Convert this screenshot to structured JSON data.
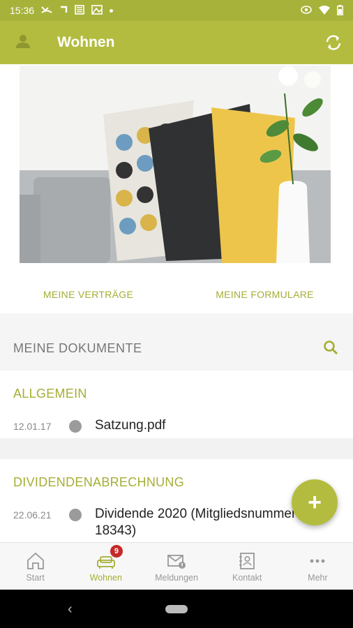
{
  "statusbar": {
    "time": "15:36"
  },
  "appbar": {
    "title": "Wohnen"
  },
  "links": {
    "contracts": "MEINE VERTRÄGE",
    "forms": "MEINE FORMULARE"
  },
  "documents": {
    "header": "MEINE DOKUMENTE",
    "sections": [
      {
        "title": "ALLGEMEIN",
        "items": [
          {
            "date": "12.01.17",
            "name": "Satzung.pdf"
          }
        ]
      },
      {
        "title": "DIVIDENDENABRECHNUNG",
        "items": [
          {
            "date": "22.06.21",
            "name": "Dividende 2020 (Mitgliedsnummer 18343)"
          }
        ]
      }
    ]
  },
  "fab": {
    "label": "+"
  },
  "bottom_nav": {
    "items": [
      {
        "label": "Start",
        "icon": "home-icon"
      },
      {
        "label": "Wohnen",
        "icon": "sofa-icon",
        "badge": "9",
        "active": true
      },
      {
        "label": "Meldungen",
        "icon": "mail-alert-icon"
      },
      {
        "label": "Kontakt",
        "icon": "contact-book-icon"
      },
      {
        "label": "Mehr",
        "icon": "more-dots-icon"
      }
    ]
  },
  "colors": {
    "accent": "#b3bc3f",
    "accent_text": "#a5ae34",
    "badge": "#c62828"
  }
}
